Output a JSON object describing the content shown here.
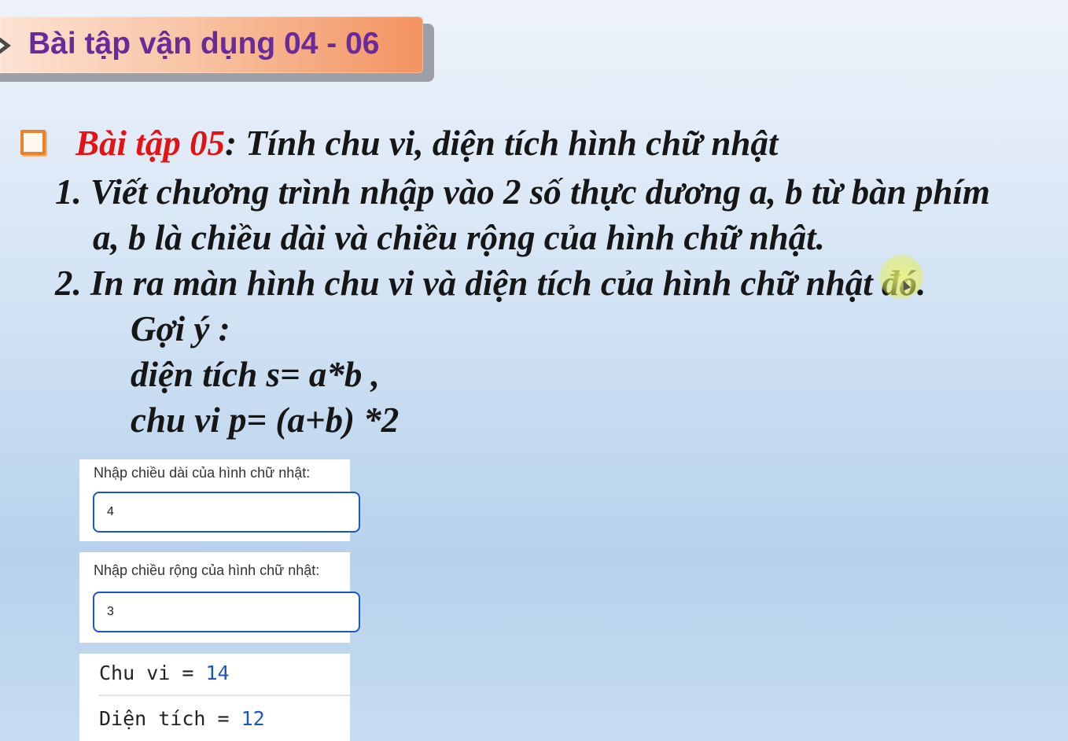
{
  "banner": {
    "title": "Bài tập vận dụng 04 - 06"
  },
  "exercise": {
    "label": "Bài tập 05",
    "title_rest": ": Tính chu vi, diện tích hình chữ nhật",
    "step1_line1": "1. Viết chương trình nhập vào 2 số thực dương a, b từ bàn phím",
    "step1_line2": "a, b là chiều dài và chiều rộng của hình chữ nhật.",
    "step2": "2. In ra màn hình chu vi và diện tích của hình chữ nhật đó.",
    "hint_title": "Gợi ý :",
    "hint_area": "diện tích s= a*b ,",
    "hint_perimeter": "chu vi p= (a+b) *2"
  },
  "form": {
    "length_label": "Nhập chiều dài của hình chữ nhật:",
    "length_value": "4",
    "width_label": "Nhập chiều rộng của hình chữ nhật:",
    "width_value": "3"
  },
  "output": {
    "perimeter_label": "Chu vi = ",
    "perimeter_value": "14",
    "area_label": "Diện tích = ",
    "area_value": "12"
  },
  "colors": {
    "title_purple": "#6a2b9a",
    "label_red": "#e31313",
    "checkbox_orange": "#e7832e",
    "input_border_blue": "#1a56c4",
    "result_number_blue": "#1b58b8"
  },
  "icons": {
    "banner_marker": "arrow-marker-icon",
    "bullet": "checkbox-bullet-icon"
  }
}
